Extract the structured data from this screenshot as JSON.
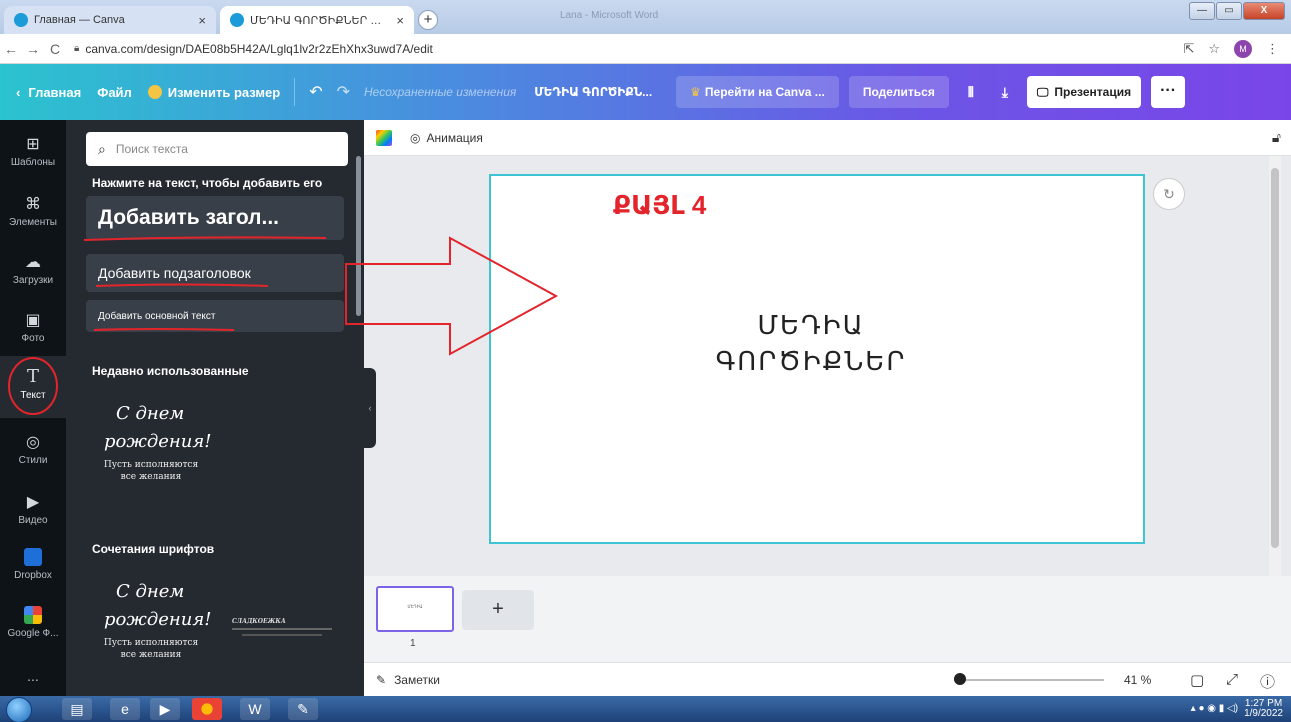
{
  "browser": {
    "tabs": [
      {
        "title": "Главная — Canva",
        "active": false
      },
      {
        "title": "ՄԵԴԻԱ ԳՈՐԾԻՔՆԵՐ — Презе",
        "active": true
      }
    ],
    "faded_title": "Lana - Microsoft Word",
    "url": "canva.com/design/DAE08b5H42A/Lglq1lv2r2zEhXhx3uwd7A/edit",
    "avatar_letter": "M"
  },
  "topbar": {
    "home": "Главная",
    "file": "Файл",
    "resize": "Изменить размер",
    "unsaved": "Несохраненные изменения",
    "title": "ՄԵԴԻԱ ԳՈՐԾԻՔՆ...",
    "go_pro": "Перейти на Canva ...",
    "share": "Поделиться",
    "present": "Презентация"
  },
  "rail": [
    {
      "label": "Шаблоны",
      "icon": "⊞"
    },
    {
      "label": "Элементы",
      "icon": "⌘"
    },
    {
      "label": "Загрузки",
      "icon": "☁"
    },
    {
      "label": "Фото",
      "icon": "▣"
    },
    {
      "label": "Текст",
      "icon": "T"
    },
    {
      "label": "Стили",
      "icon": "◎"
    },
    {
      "label": "Видео",
      "icon": "▶"
    },
    {
      "label": "Dropbox",
      "icon": ""
    },
    {
      "label": "Google Ф...",
      "icon": ""
    },
    {
      "label": "...",
      "icon": ""
    }
  ],
  "panel": {
    "search_placeholder": "Поиск текста",
    "click_hint": "Нажмите на текст, чтобы добавить его",
    "add_heading": "Добавить загол...",
    "add_subheading": "Добавить подзаголовок",
    "add_body": "Добавить основной текст",
    "recent_title": "Недавно использованные",
    "combos_title": "Сочетания шрифтов",
    "card_script_1": "С днем",
    "card_script_2": "рождения!",
    "card_sub_1": "Пусть исполняются",
    "card_sub_2": "все желания",
    "card_small": "СЛАДКОЕЖКА"
  },
  "canvas": {
    "animation": "Анимация",
    "slide_head": "ՔԱՅԼ 4",
    "slide_main_1": "ՄԵԴԻԱ",
    "slide_main_2": "ԳՈՐԾԻՔՆԵՐ",
    "page_number": "1",
    "notes": "Заметки",
    "zoom": "41 %",
    "zoom_level_fraction": 0.0
  },
  "taskbar": {
    "time": "1:27 PM",
    "date": "1/9/2022"
  },
  "colors": {
    "accent": "#7d63e8",
    "annotation_red": "#e3242b",
    "slide_border": "#3fc4d4"
  }
}
